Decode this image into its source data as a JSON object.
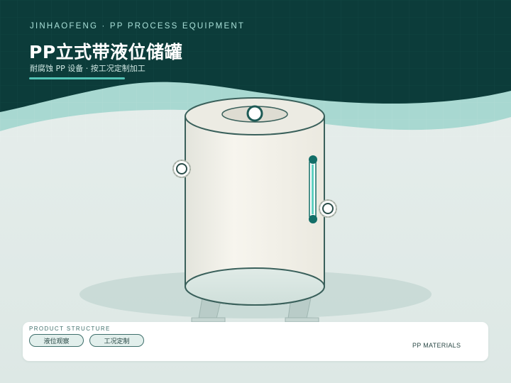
{
  "header": {
    "brand": "JINHAOFENG · PP PROCESS EQUIPMENT",
    "title": "PP立式带液位储罐",
    "subtitle": "耐腐蚀 PP 设备 · 按工况定制加工"
  },
  "panel": {
    "section_label": "PRODUCT STRUCTURE",
    "tags": [
      "液位观察",
      "工况定制"
    ],
    "materials_label": "PP MATERIALS"
  },
  "colors": {
    "header_bg": "#0c3c3a",
    "accent": "#52c3b5",
    "tank_outline": "#3a605b",
    "tank_body": "#f2f0e8",
    "level_gauge": "#136e68"
  },
  "icons": {
    "top_nozzle": "nozzle-flange-icon",
    "side_nozzle": "nozzle-flange-icon"
  }
}
